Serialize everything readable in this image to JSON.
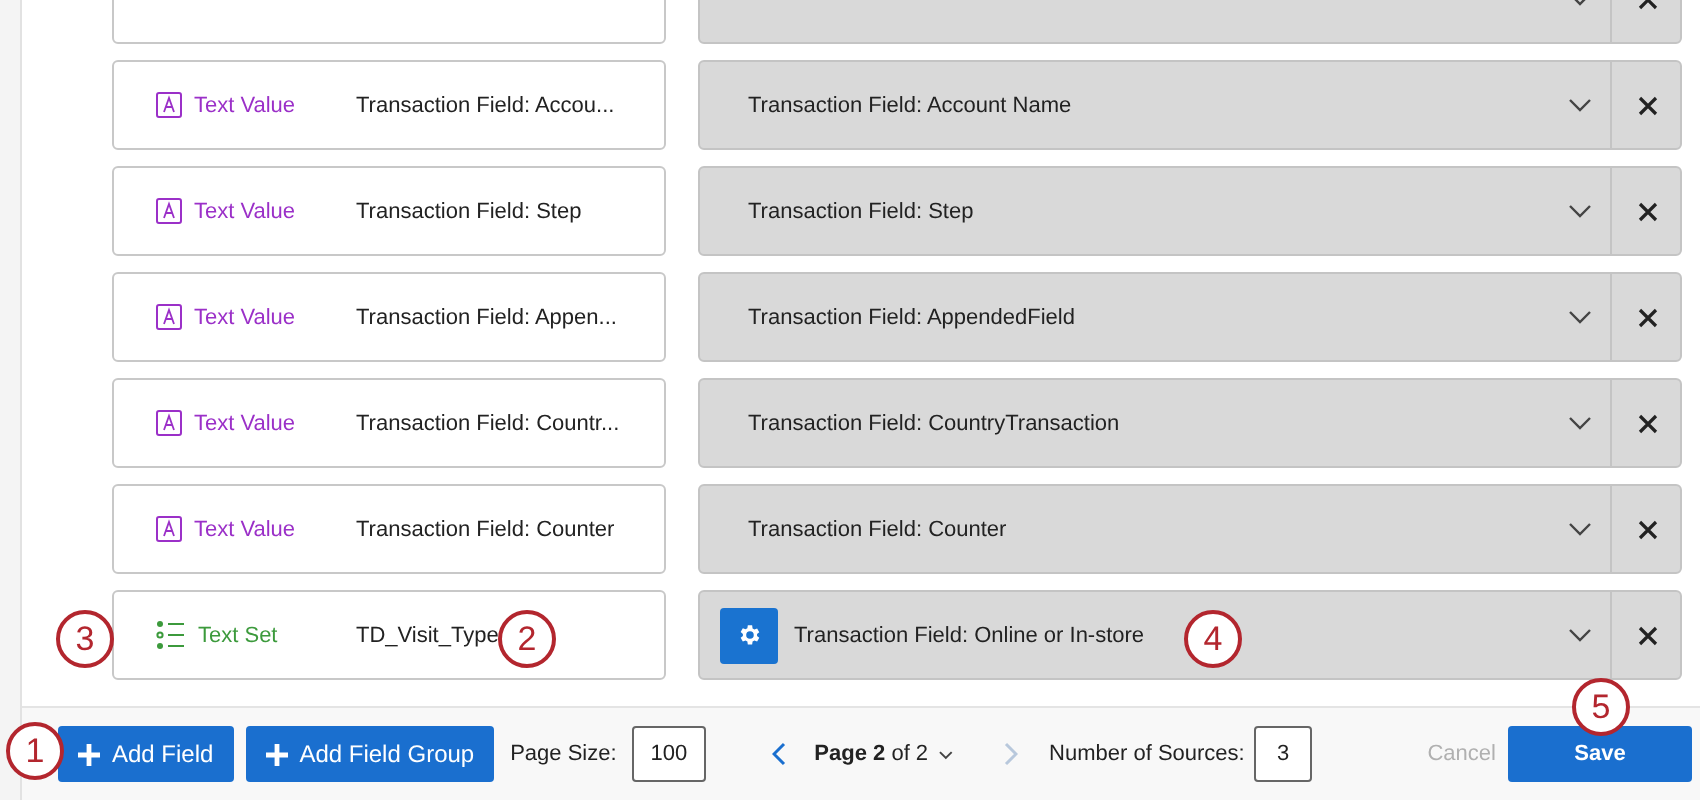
{
  "fields": [
    {
      "kind": "text_value",
      "type_label": "Text Value",
      "name": "Transaction Field: Accou...",
      "mapping": "Transaction Field: Account Name",
      "gear": false
    },
    {
      "kind": "text_value",
      "type_label": "Text Value",
      "name": "Transaction Field: Step",
      "mapping": "Transaction Field: Step",
      "gear": false
    },
    {
      "kind": "text_value",
      "type_label": "Text Value",
      "name": "Transaction Field: Appen...",
      "mapping": "Transaction Field: AppendedField",
      "gear": false
    },
    {
      "kind": "text_value",
      "type_label": "Text Value",
      "name": "Transaction Field: Countr...",
      "mapping": "Transaction Field: CountryTransaction",
      "gear": false
    },
    {
      "kind": "text_value",
      "type_label": "Text Value",
      "name": "Transaction Field: Counter",
      "mapping": "Transaction Field: Counter",
      "gear": false
    },
    {
      "kind": "text_set",
      "type_label": "Text Set",
      "name": "TD_Visit_Type",
      "mapping": "Transaction Field: Online or In-store",
      "gear": true
    }
  ],
  "footer": {
    "add_field": "Add Field",
    "add_group": "Add Field Group",
    "page_size_label": "Page Size:",
    "page_size": "100",
    "page": "**Page 2** of 2",
    "prev_disabled": false,
    "next_disabled": true,
    "sources_label": "Number of Sources:",
    "sources": "3",
    "cancel": "Cancel",
    "cancel_disabled": true,
    "save": "Save"
  },
  "callouts": [
    "3",
    "2",
    "4",
    "5",
    "1"
  ]
}
